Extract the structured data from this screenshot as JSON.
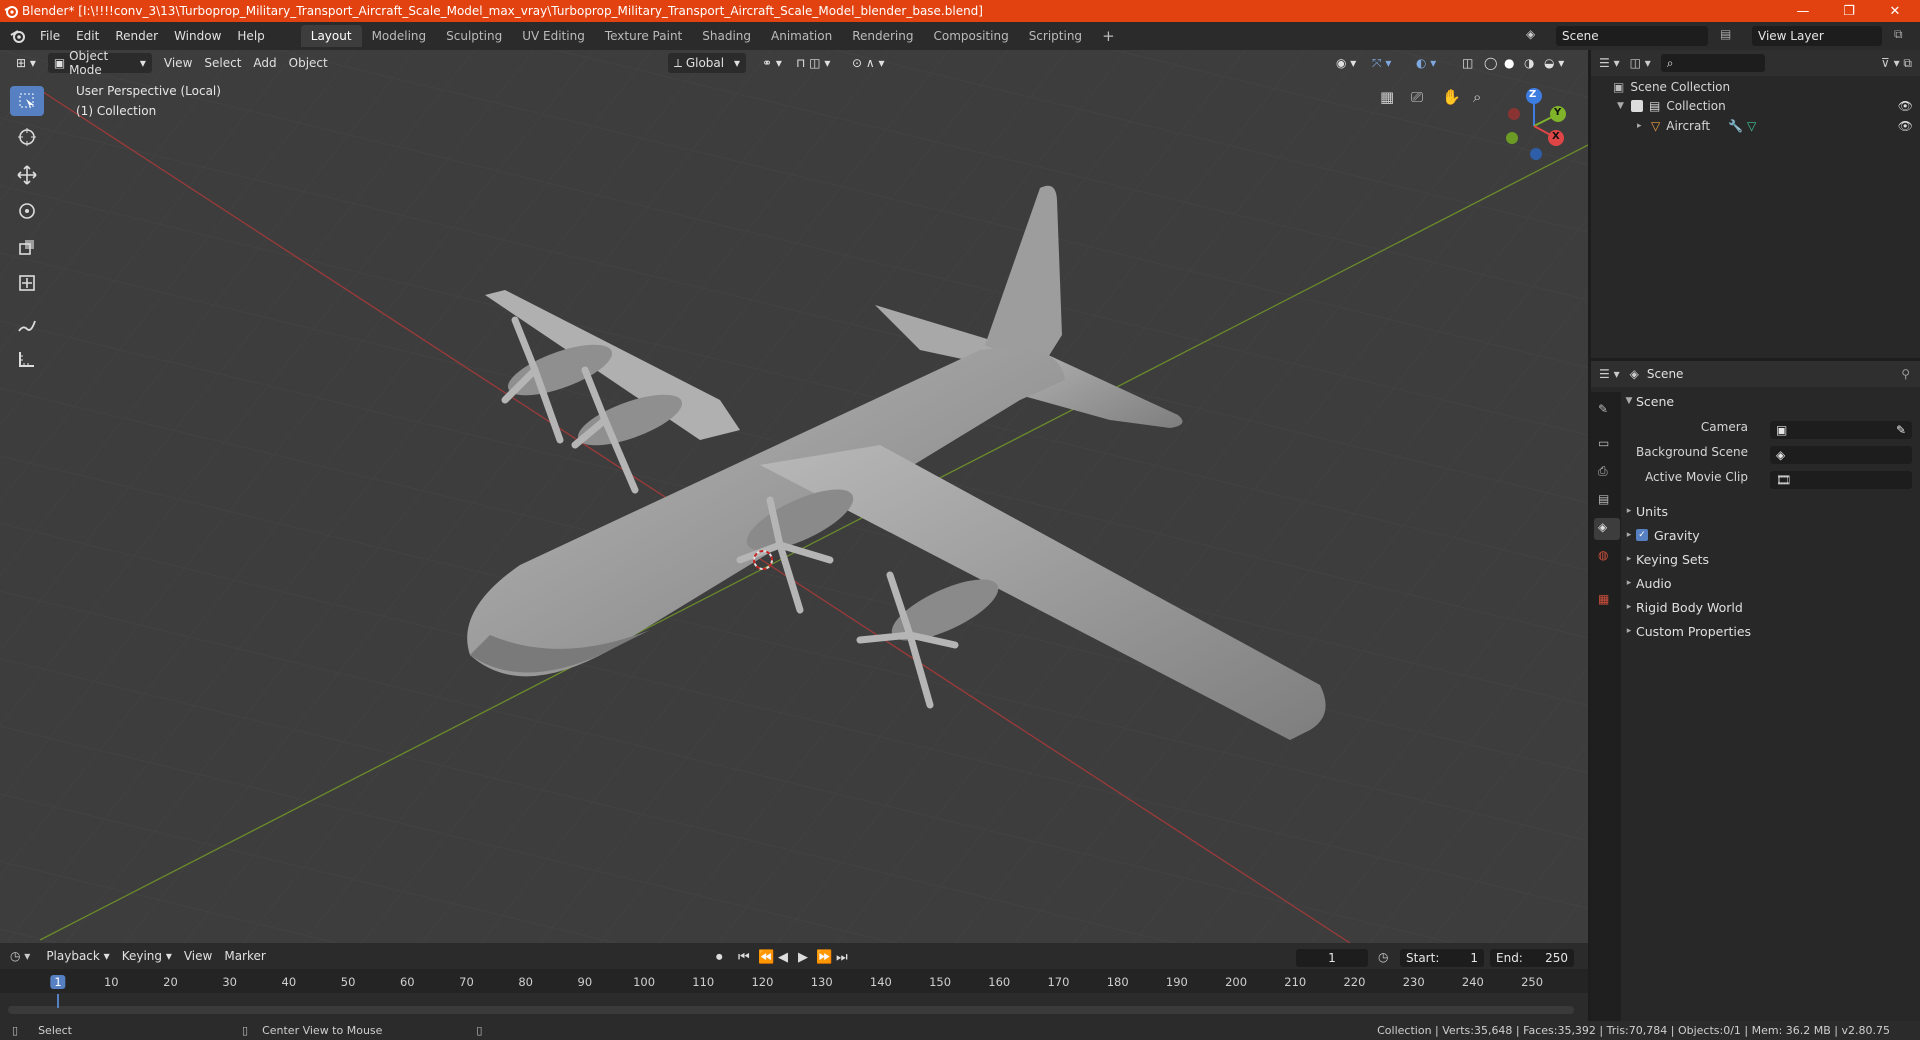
{
  "title_bar": {
    "title": "Blender* [I:\\!!!!conv_3\\13\\Turboprop_Military_Transport_Aircraft_Scale_Model_max_vray\\Turboprop_Military_Transport_Aircraft_Scale_Model_blender_base.blend]",
    "minimize": "—",
    "maximize": "❐",
    "close": "✕"
  },
  "menus": [
    "File",
    "Edit",
    "Render",
    "Window",
    "Help"
  ],
  "workspaces": [
    "Layout",
    "Modeling",
    "Sculpting",
    "UV Editing",
    "Texture Paint",
    "Shading",
    "Animation",
    "Rendering",
    "Compositing",
    "Scripting"
  ],
  "add_workspace": "+",
  "scene_field": "Scene",
  "view_layer_field": "View Layer",
  "viewport": {
    "mode": "Object Mode",
    "menus": [
      "View",
      "Select",
      "Add",
      "Object"
    ],
    "transform_orientation": "Global",
    "overlay_line1": "User Perspective (Local)",
    "overlay_line2": "(1) Collection",
    "gizmo": {
      "z": "Z",
      "y": "Y",
      "x": "X"
    }
  },
  "outliner": {
    "search_placeholder": "",
    "root": "Scene Collection",
    "collection": "Collection",
    "object": "Aircraft"
  },
  "properties": {
    "context": "Scene",
    "panel_title": "Scene",
    "camera_label": "Camera",
    "background_scene_label": "Background Scene",
    "active_movie_clip_label": "Active Movie Clip",
    "sections": [
      "Units",
      "Gravity",
      "Keying Sets",
      "Audio",
      "Rigid Body World",
      "Custom Properties"
    ]
  },
  "timeline": {
    "menus": [
      "Playback",
      "Keying",
      "View",
      "Marker"
    ],
    "current_frame": "1",
    "start_label": "Start:",
    "start_value": "1",
    "end_label": "End:",
    "end_value": "250",
    "ticks": [
      "1",
      "10",
      "20",
      "30",
      "40",
      "50",
      "60",
      "70",
      "80",
      "90",
      "100",
      "110",
      "120",
      "130",
      "140",
      "150",
      "160",
      "170",
      "180",
      "190",
      "200",
      "210",
      "220",
      "230",
      "240",
      "250"
    ]
  },
  "status_bar": {
    "left_action": "Select",
    "middle_action": "Center View to Mouse",
    "stats": "Collection | Verts:35,648 | Faces:35,392 | Tris:70,784 | Objects:0/1 | Mem: 36.2 MB | v2.80.75"
  },
  "colors": {
    "accent": "#5680c2",
    "titlebar": "#e2420f",
    "viewport": "#3d3d3d",
    "model": "#9a9a9a"
  }
}
